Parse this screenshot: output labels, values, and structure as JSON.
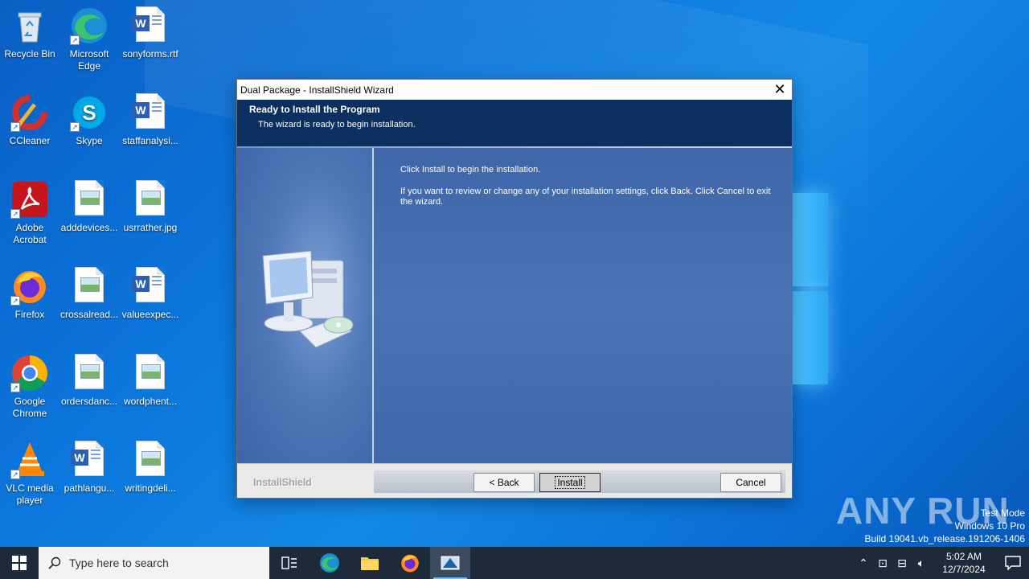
{
  "desktop": {
    "icons": [
      {
        "label": "Recycle Bin"
      },
      {
        "label": "Microsoft Edge"
      },
      {
        "label": "sonyforms.rtf"
      },
      {
        "label": "CCleaner"
      },
      {
        "label": "Skype"
      },
      {
        "label": "staffanalysi..."
      },
      {
        "label": "Adobe Acrobat"
      },
      {
        "label": "adddevices..."
      },
      {
        "label": "usrrather.jpg"
      },
      {
        "label": "Firefox"
      },
      {
        "label": "crossalread..."
      },
      {
        "label": "valueexpec..."
      },
      {
        "label": "Google Chrome"
      },
      {
        "label": "ordersdanc..."
      },
      {
        "label": "wordphent..."
      },
      {
        "label": "VLC media player"
      },
      {
        "label": "pathlangu..."
      },
      {
        "label": "writingdeli..."
      }
    ]
  },
  "dialog": {
    "title": "Dual Package - InstallShield Wizard",
    "heading": "Ready to Install the Program",
    "subheading": "The wizard is ready to begin installation.",
    "text1": "Click Install to begin the installation.",
    "text2": "If you want to review or change any of your installation settings, click Back. Click Cancel to exit the wizard.",
    "brand": "InstallShield",
    "back_label": "< Back",
    "install_label": "Install",
    "cancel_label": "Cancel"
  },
  "watermark": {
    "text": "ANY RUN",
    "line1": "Test Mode",
    "line2": "Windows 10 Pro",
    "line3": "Build 19041.vb_release.191206-1406"
  },
  "taskbar": {
    "search_placeholder": "Type here to search",
    "time": "5:02 AM",
    "date": "12/7/2024"
  }
}
